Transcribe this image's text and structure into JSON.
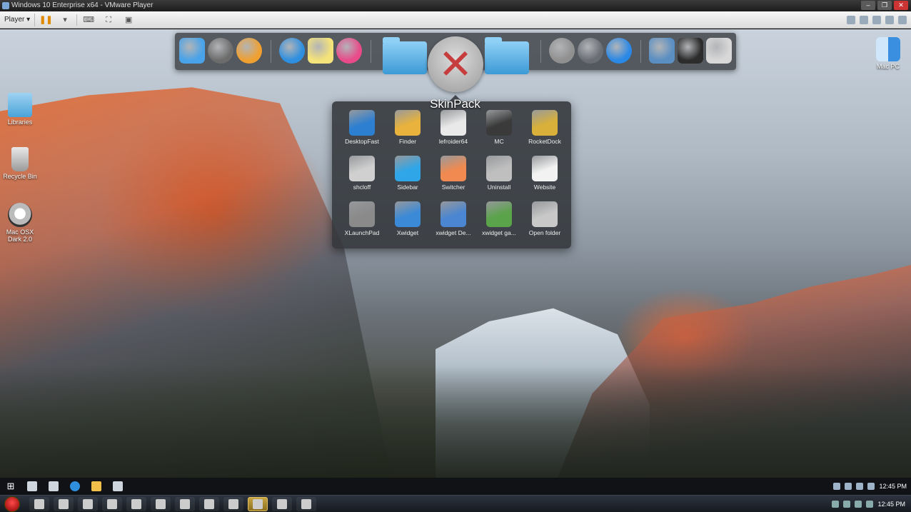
{
  "window": {
    "title": "Windows 10 Enterprise x64 - VMware Player",
    "buttons": [
      "–",
      "❐",
      "✕"
    ]
  },
  "vm_toolbar": {
    "player_menu": "Player ▾",
    "icons": [
      "pause-icon",
      "send-keys-icon",
      "fullscreen-icon",
      "unity-icon"
    ]
  },
  "desktop_icons": [
    {
      "label": "Libraries",
      "icon": "folder-icon"
    },
    {
      "label": "Recycle Bin",
      "icon": "recycle-bin-icon"
    },
    {
      "label": "Mac OSX Dark 2.0",
      "icon": "osx-disc-icon"
    },
    {
      "label": "Mac PC",
      "icon": "mac-pc-icon"
    }
  ],
  "dock": {
    "items": [
      {
        "name": "finder",
        "color": "#4aa3e8"
      },
      {
        "name": "system-preferences",
        "color": "#6c6c6c"
      },
      {
        "name": "photos",
        "color": "#f0a030"
      },
      {
        "name": "safari",
        "color": "#2e8fe0"
      },
      {
        "name": "notes",
        "color": "#f4e27a"
      },
      {
        "name": "itunes",
        "color": "#e84a8a"
      },
      {
        "name": "power",
        "color": "#909090"
      },
      {
        "name": "launchpad",
        "color": "#6a6e74"
      },
      {
        "name": "app-store",
        "color": "#2a88e6"
      },
      {
        "name": "photo-gallery",
        "color": "#5b8fc2"
      },
      {
        "name": "widgets",
        "color": "#2c2c2c"
      },
      {
        "name": "trash",
        "color": "#d8d8d8"
      }
    ]
  },
  "popup": {
    "title": "SkinPack",
    "items": [
      {
        "label": "DesktopFast",
        "color": "#2d7fd1"
      },
      {
        "label": "Finder",
        "color": "#e8b23c"
      },
      {
        "label": "lefroider64",
        "color": "#e9e9e9"
      },
      {
        "label": "MC",
        "color": "#3a3a3a"
      },
      {
        "label": "RocketDock",
        "color": "#d8b03a"
      },
      {
        "label": "shcloff",
        "color": "#d0d0d0"
      },
      {
        "label": "Sidebar",
        "color": "#2fa6e8"
      },
      {
        "label": "Switcher",
        "color": "#f08a50"
      },
      {
        "label": "Uninstall",
        "color": "#bfbfbf"
      },
      {
        "label": "Website",
        "color": "#f2f2f2"
      },
      {
        "label": "XLaunchPad",
        "color": "#8a8a8a"
      },
      {
        "label": "Xwidget",
        "color": "#3a8ad8"
      },
      {
        "label": "xwidget De...",
        "color": "#4a86d2"
      },
      {
        "label": "xwidget ga...",
        "color": "#5aa34a"
      },
      {
        "label": "Open folder",
        "color": "#c8c8c8"
      }
    ]
  },
  "inner_taskbar": {
    "clock": "12:45 PM"
  },
  "host_taskbar": {
    "clock": "12:45 PM"
  }
}
